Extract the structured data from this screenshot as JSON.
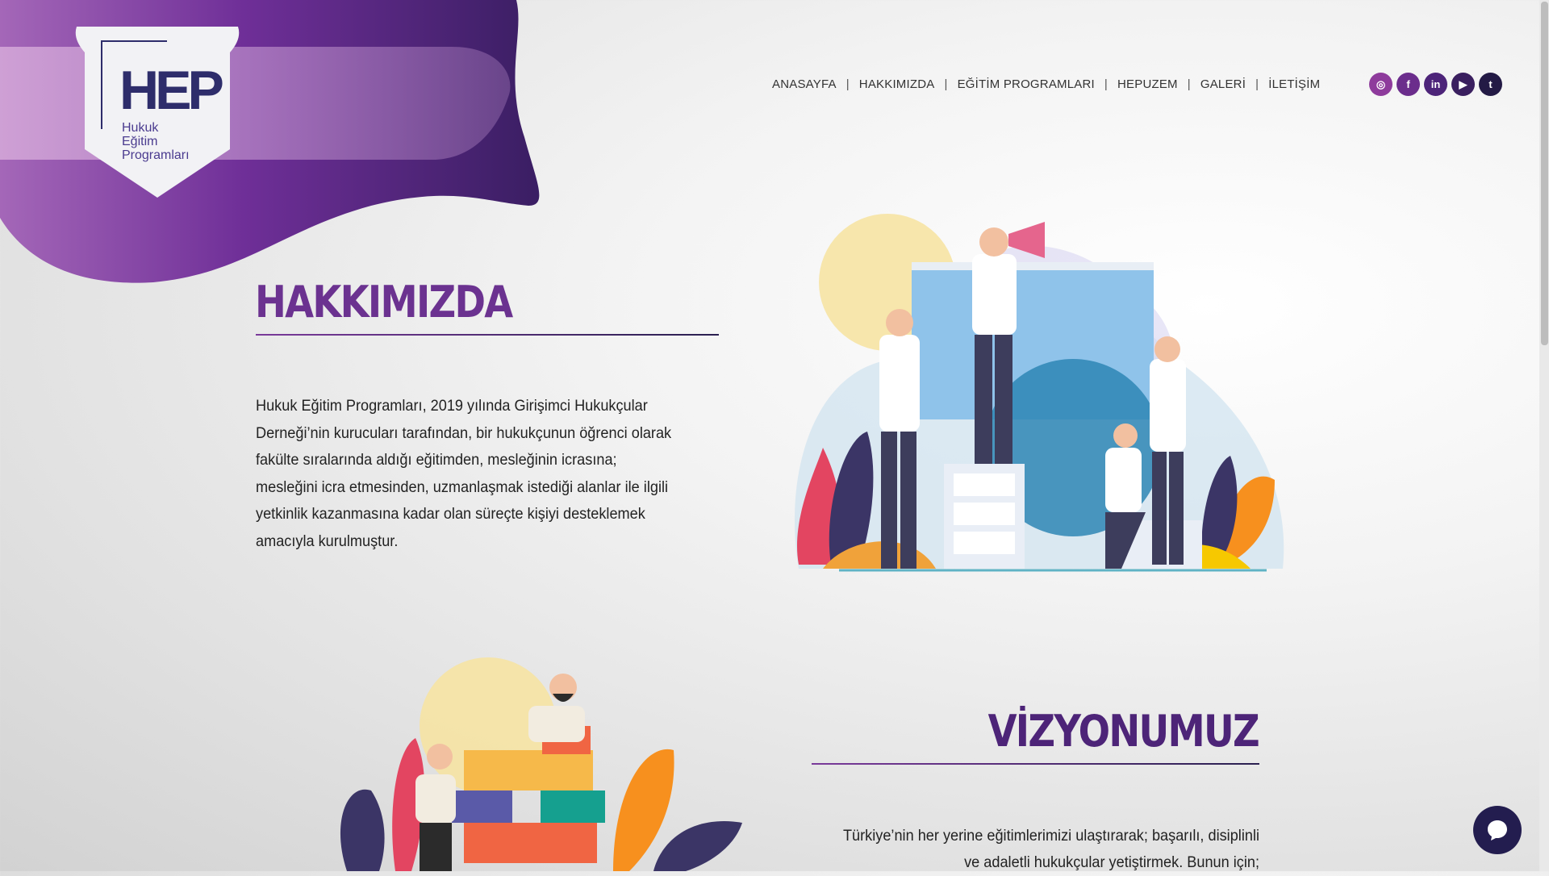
{
  "brand": {
    "logo_mark": "HEP",
    "logo_subtitle": "Hukuk\nEğitim\nProgramları"
  },
  "nav": {
    "items": [
      "ANASAYFA",
      "HAKKIMIZDA",
      "EĞİTİM PROGRAMLARI",
      "HEPUZEM",
      "GALERİ",
      "İLETİŞİM"
    ],
    "separator": "|"
  },
  "social": {
    "icons": [
      "instagram-icon",
      "facebook-icon",
      "linkedin-icon",
      "youtube-icon",
      "twitter-icon"
    ],
    "glyphs": [
      "◎",
      "f",
      "in",
      "▶",
      "t"
    ]
  },
  "about": {
    "title": "HAKKIMIZDA",
    "text": "Hukuk Eğitim Programları, 2019 yılında Girişimci Hukukçular Derneği’nin kurucuları tarafından, bir hukukçunun öğrenci olarak fakülte sıralarında aldığı eğitimden, mesleğinin icrasına; mesleğini icra etmesinden, uzmanlaşmak istediği alanlar ile ilgili yetkinlik kazanmasına kadar olan süreçte kişiyi desteklemek amacıyla kurulmuştur."
  },
  "vision": {
    "title": "VİZYONUMUZ",
    "text": "Türkiye’nin her yerine eğitimlerimizi ulaştırarak; başarılı, disiplinli ve adaletli hukukçular yetiştirmek. Bunun için;"
  },
  "colors": {
    "brand_purple": "#6b3290",
    "dark_navy": "#2e2d6b",
    "chat_bg": "#231d4f"
  }
}
